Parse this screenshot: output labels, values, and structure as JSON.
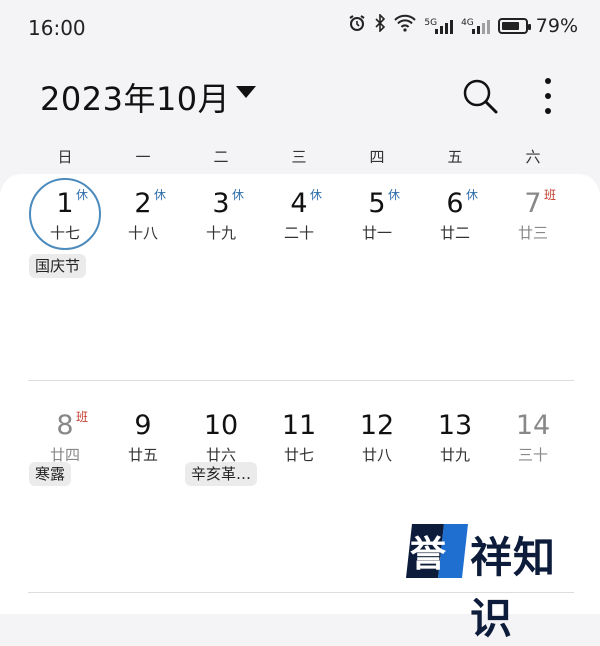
{
  "status_bar": {
    "time": "16:00",
    "icons": [
      "alarm-icon",
      "bluetooth-icon",
      "wifi-icon",
      "signal-5g-icon",
      "signal-4g-icon",
      "battery-icon"
    ],
    "net1": "5G",
    "net2": "4G",
    "battery_percent": "79%",
    "battery_level": 0.79
  },
  "header": {
    "title": "2023年10月"
  },
  "weekdays": [
    "日",
    "一",
    "二",
    "三",
    "四",
    "五",
    "六"
  ],
  "weeks": [
    {
      "days": [
        {
          "num": "1",
          "lunar": "十七",
          "badge": "休",
          "badge_type": "rest",
          "today": true
        },
        {
          "num": "2",
          "lunar": "十八",
          "badge": "休",
          "badge_type": "rest"
        },
        {
          "num": "3",
          "lunar": "十九",
          "badge": "休",
          "badge_type": "rest"
        },
        {
          "num": "4",
          "lunar": "二十",
          "badge": "休",
          "badge_type": "rest"
        },
        {
          "num": "5",
          "lunar": "廿一",
          "badge": "休",
          "badge_type": "rest"
        },
        {
          "num": "6",
          "lunar": "廿二",
          "badge": "休",
          "badge_type": "rest"
        },
        {
          "num": "7",
          "lunar": "廿三",
          "badge": "班",
          "badge_type": "work",
          "grey": true
        }
      ],
      "events": [
        {
          "label": "国庆节",
          "column": 0
        }
      ]
    },
    {
      "days": [
        {
          "num": "8",
          "lunar": "廿四",
          "badge": "班",
          "badge_type": "work",
          "grey": true
        },
        {
          "num": "9",
          "lunar": "廿五"
        },
        {
          "num": "10",
          "lunar": "廿六"
        },
        {
          "num": "11",
          "lunar": "廿七"
        },
        {
          "num": "12",
          "lunar": "廿八"
        },
        {
          "num": "13",
          "lunar": "廿九"
        },
        {
          "num": "14",
          "lunar": "三十",
          "grey": true
        }
      ],
      "events": [
        {
          "label": "寒露",
          "column": 0
        },
        {
          "label": "辛亥革…",
          "column": 2
        }
      ]
    }
  ],
  "colors": {
    "rest_badge": "#2f6fab",
    "work_badge": "#c0392b",
    "today_ring": "#4c8bbd",
    "watermark_blue": "#1f6fd0",
    "watermark_dark": "#0c1c3a"
  },
  "watermark": {
    "logo_text": "誉",
    "text": "祥知识"
  }
}
